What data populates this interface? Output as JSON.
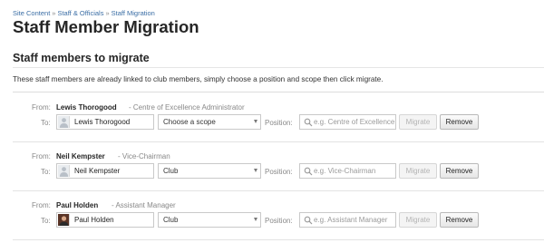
{
  "breadcrumb": {
    "items": [
      "Site Content",
      "Staff & Officials",
      "Staff Migration"
    ],
    "separator": "»"
  },
  "page": {
    "title": "Staff Member Migration",
    "section_heading": "Staff members to migrate",
    "intro": "These staff members are already linked to club members, simply choose a position and scope then click migrate."
  },
  "labels": {
    "from": "From:",
    "to": "To:",
    "position": "Position:",
    "migrate": "Migrate",
    "remove": "Remove"
  },
  "members": [
    {
      "name": "Lewis Thorogood",
      "role": "- Centre of Excellence Administrator",
      "linked_user": "Lewis Thorogood",
      "avatar": "default",
      "scope": "Choose a scope",
      "position_value": "",
      "position_placeholder": "e.g. Centre of Excellence Administrator"
    },
    {
      "name": "Neil Kempster",
      "role": "- Vice-Chairman",
      "linked_user": "Neil Kempster",
      "avatar": "default",
      "scope": "Club",
      "position_value": "",
      "position_placeholder": "e.g. Vice-Chairman"
    },
    {
      "name": "Paul Holden",
      "role": "- Assistant Manager",
      "linked_user": "Paul Holden",
      "avatar": "photo",
      "scope": "Club",
      "position_value": "",
      "position_placeholder": "e.g. Assistant Manager"
    }
  ],
  "colors": {
    "link": "#3b6ea5",
    "heading": "#262626",
    "muted": "#888888",
    "border": "#c9c9c9"
  }
}
